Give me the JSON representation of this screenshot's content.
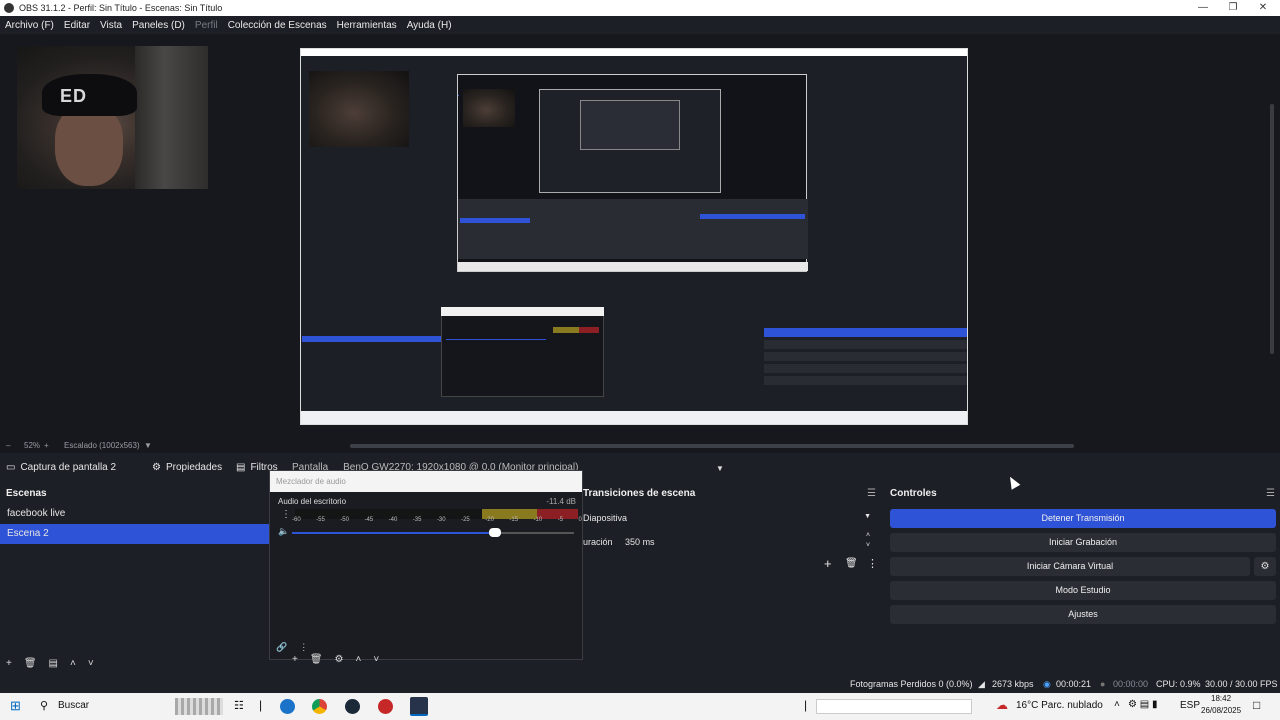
{
  "window": {
    "title": "OBS 31.1.2 - Perfil: Sin Título - Escenas: Sin Título"
  },
  "menu": {
    "items": [
      "Archivo (F)",
      "Editar",
      "Vista",
      "Paneles (D)",
      "Perfil",
      "Colección de Escenas",
      "Herramientas",
      "Ayuda (H)"
    ]
  },
  "camera": {
    "hat_text": "ED"
  },
  "preview": {
    "zoom": "52%",
    "scale_label": "Escalado (1002x563)"
  },
  "source_bar": {
    "source_name": "Captura de pantalla 2",
    "properties": "Propiedades",
    "filters": "Filtros",
    "display_label": "Pantalla",
    "display_value": "BenQ GW2270: 1920x1080 @ 0,0 (Monitor principal)"
  },
  "scenes": {
    "title": "Escenas",
    "items": [
      {
        "label": "facebook live",
        "selected": false
      },
      {
        "label": "Escena 2",
        "selected": true
      }
    ]
  },
  "mixer": {
    "title": "Mezclador de audio",
    "channel": "Audio del escritorio",
    "db": "-11.4 dB",
    "ticks": [
      "-60",
      "-55",
      "-50",
      "-45",
      "-40",
      "-35",
      "-30",
      "-25",
      "-20",
      "-15",
      "-10",
      "-5",
      "0"
    ],
    "volume_level": 0.72
  },
  "transitions": {
    "title": "Transiciones de escena",
    "type": "Diapositiva",
    "duration_label": "uración",
    "duration_value": "350 ms"
  },
  "controls": {
    "title": "Controles",
    "buttons": [
      "Detener Transmisión",
      "Iniciar Grabación",
      "Iniciar Cámara Virtual",
      "Modo Estudio",
      "Ajustes"
    ]
  },
  "status": {
    "dropped": "Fotogramas Perdidos 0 (0.0%)",
    "bitrate": "2673 kbps",
    "stream_time": "00:00:21",
    "rec_time": "00:00:00",
    "cpu": "CPU: 0.9%",
    "fps": "30.00 / 30.00 FPS"
  },
  "taskbar": {
    "search": "Buscar",
    "weather": "16°C  Parc. nublado",
    "lang": "ESP",
    "time": "18:42",
    "date": "26/08/2025"
  },
  "colors": {
    "accent": "#2f53d6",
    "background": "#1d1f26"
  }
}
